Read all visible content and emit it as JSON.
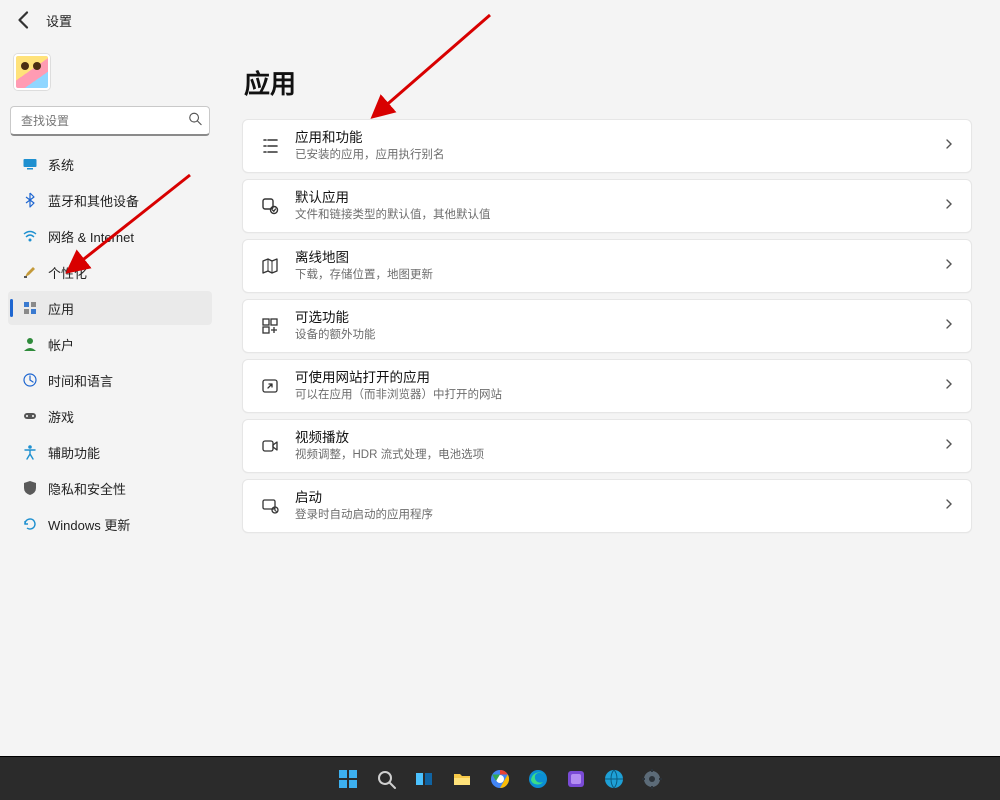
{
  "header": {
    "app_title": "设置"
  },
  "search": {
    "placeholder": "查找设置"
  },
  "sidebar": {
    "items": [
      {
        "name": "system",
        "label": "系统"
      },
      {
        "name": "bluetooth",
        "label": "蓝牙和其他设备"
      },
      {
        "name": "network",
        "label": "网络 & Internet"
      },
      {
        "name": "personalize",
        "label": "个性化"
      },
      {
        "name": "apps",
        "label": "应用",
        "active": true
      },
      {
        "name": "accounts",
        "label": "帐户"
      },
      {
        "name": "time-lang",
        "label": "时间和语言"
      },
      {
        "name": "gaming",
        "label": "游戏"
      },
      {
        "name": "accessibility",
        "label": "辅助功能"
      },
      {
        "name": "privacy",
        "label": "隐私和安全性"
      },
      {
        "name": "update",
        "label": "Windows 更新"
      }
    ]
  },
  "page": {
    "title": "应用"
  },
  "cards": [
    {
      "name": "apps-features",
      "title": "应用和功能",
      "sub": "已安装的应用，应用执行别名"
    },
    {
      "name": "default-apps",
      "title": "默认应用",
      "sub": "文件和链接类型的默认值，其他默认值"
    },
    {
      "name": "offline-maps",
      "title": "离线地图",
      "sub": "下载，存储位置，地图更新"
    },
    {
      "name": "optional",
      "title": "可选功能",
      "sub": "设备的额外功能"
    },
    {
      "name": "apps-websites",
      "title": "可使用网站打开的应用",
      "sub": "可以在应用（而非浏览器）中打开的网站"
    },
    {
      "name": "video-playback",
      "title": "视频播放",
      "sub": "视频调整，HDR 流式处理，电池选项"
    },
    {
      "name": "startup",
      "title": "启动",
      "sub": "登录时自动启动的应用程序"
    }
  ],
  "annotation": {
    "color": "#d80000"
  }
}
